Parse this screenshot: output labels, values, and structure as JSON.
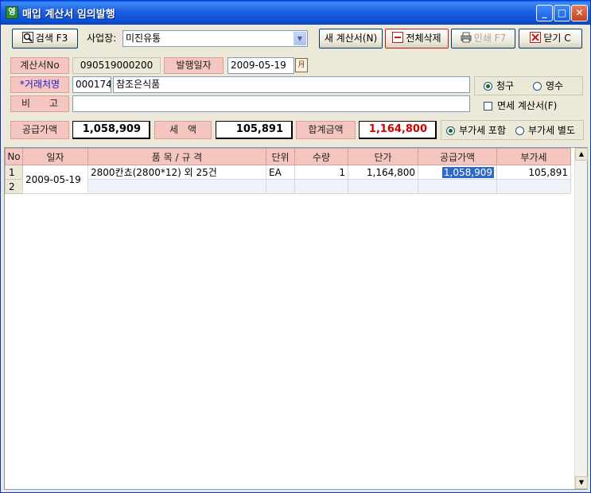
{
  "window": {
    "title": "매입 계산서 임의발행",
    "icon": "receipt-app-icon",
    "controls": {
      "minimize": "_",
      "maximize": "□",
      "close": "✕"
    }
  },
  "toolbar": {
    "search_label": "검색 F3",
    "site_label": "사업장:",
    "site_value": "미진유통",
    "new_label": "새 계산서(N)",
    "delete_all_label": "전체삭제",
    "print_label": "인쇄 F7",
    "close_label": "닫기 C"
  },
  "form": {
    "invoice_no_label": "계산서No",
    "invoice_no_value": "090519000200",
    "issue_date_label": "발행일자",
    "issue_date_value": "2009-05-19",
    "calendar_glyph": "月",
    "customer_label": "*거래처명",
    "customer_code": "000174",
    "customer_name": "참조은식품",
    "remarks_label": "비　　고",
    "remarks_value": "",
    "claim_label": "청구",
    "receipt_label": "영수",
    "claim_selected": true,
    "taxfree_label": "면세 계산서(F)",
    "taxfree_checked": false
  },
  "totals": {
    "supply_label": "공급가액",
    "supply_value": "1,058,909",
    "tax_label": "세　액",
    "tax_value": "105,891",
    "sum_label": "합계금액",
    "sum_value": "1,164,800",
    "vat_include_label": "부가세 포함",
    "vat_separate_label": "부가세 별도",
    "vat_include_selected": true
  },
  "grid": {
    "headers": [
      "No",
      "일자",
      "품 목 / 규 격",
      "단위",
      "수량",
      "단가",
      "공급가액",
      "부가세"
    ],
    "rows": [
      {
        "no": "1",
        "date": "2009-05-19",
        "item": "2800칸쵸(2800*12) 외 25건",
        "unit": "EA",
        "qty": "1",
        "price": "1,164,800",
        "supply": "1,058,909",
        "vat": "105,891"
      },
      {
        "no": "2",
        "date": "",
        "item": "",
        "unit": "",
        "qty": "",
        "price": "",
        "supply": "",
        "vat": ""
      }
    ]
  },
  "colors": {
    "label_bg": "#f5c6c0",
    "title_bar": "#0b4fd6",
    "selection": "#3169c6",
    "total_red": "#d00000"
  }
}
